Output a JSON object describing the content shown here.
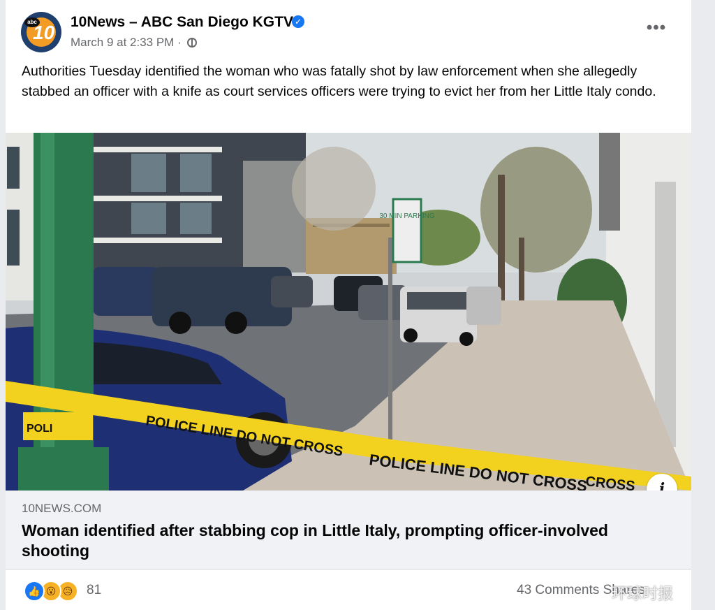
{
  "post": {
    "page_name": "10News – ABC San Diego KGTV",
    "avatar_text": "10",
    "avatar_network": "abc",
    "timestamp": "March 9 at 2:33 PM ·",
    "body": "Authorities Tuesday identified the woman who was fatally shot by law enforcement when she allegedly stabbed an officer with a knife as court services officers were trying to evict her from her Little Italy condo.",
    "more_label": "•••"
  },
  "link": {
    "domain": "10NEWS.COM",
    "title": "Woman identified after stabbing cop in Little Italy, prompting officer-involved shooting",
    "info_label": "i"
  },
  "photo": {
    "tape_text_1": "POLICE LINE DO NOT CROSS",
    "tape_text_2": "POLICE LINE DO NOT CROSS",
    "tape_text_3": "CROSS",
    "tape_text_4": "POLI",
    "sign_text": "30 MIN PARKING"
  },
  "footer": {
    "reaction_count": "81",
    "comments": "43 Comments",
    "shares": "Shares",
    "watermark": "环球时报"
  },
  "colors": {
    "like_blue": "#1877f2",
    "tape_yellow": "#f3d11f",
    "car_blue": "#1e2f73",
    "pole_green": "#2b7a4f"
  },
  "icons": [
    "verified-badge-icon",
    "globe-icon",
    "more-icon",
    "info-icon",
    "like-reaction-icon",
    "wow-reaction-icon",
    "sad-reaction-icon"
  ]
}
